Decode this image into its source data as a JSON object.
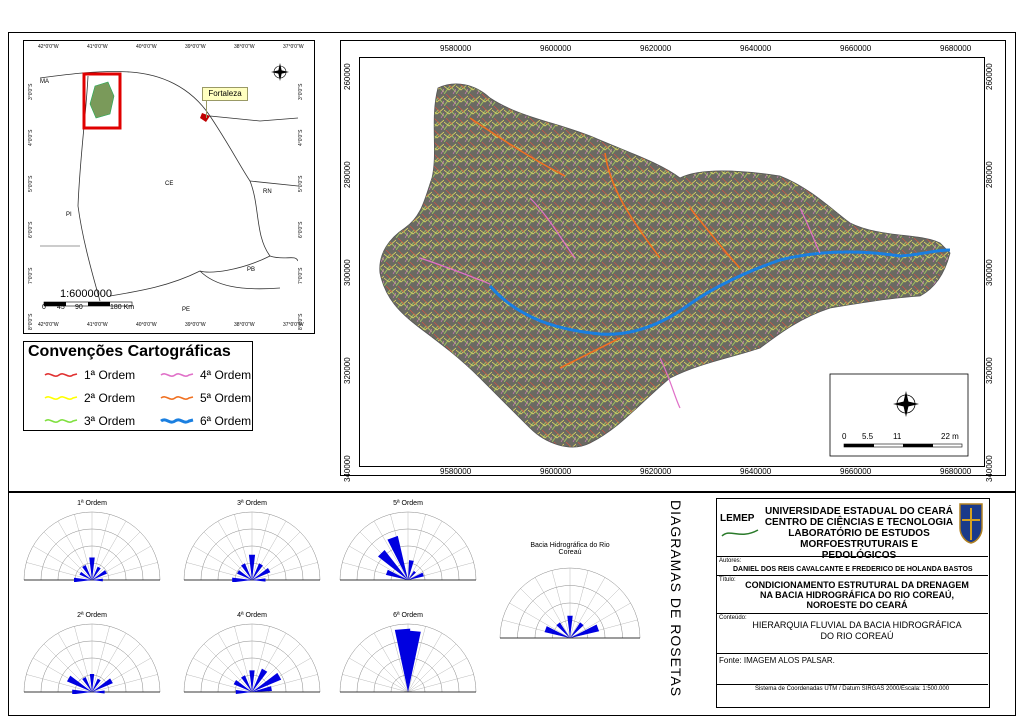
{
  "locator_map": {
    "top_ticks": [
      "42°0'0\"W",
      "41°0'0\"W",
      "40°0'0\"W",
      "39°0'0\"W",
      "38°0'0\"W",
      "37°0'0\"W"
    ],
    "bottom_ticks": [
      "42°0'0\"W",
      "41°0'0\"W",
      "40°0'0\"W",
      "39°0'0\"W",
      "38°0'0\"W",
      "37°0'0\"W"
    ],
    "left_ticks": [
      "3°0'0\"S",
      "4°0'0\"S",
      "5°0'0\"S",
      "6°0'0\"S",
      "7°0'0\"S",
      "8°0'0\"S"
    ],
    "right_ticks": [
      "3°0'0\"S",
      "4°0'0\"S",
      "5°0'0\"S",
      "6°0'0\"S",
      "7°0'0\"S",
      "8°0'0\"S"
    ],
    "state_labels": {
      "ma": "MA",
      "ce": "CE",
      "pi": "PI",
      "rn": "RN",
      "pb": "PB",
      "pe": "PE"
    },
    "city_label": "Fortaleza",
    "scale_ratio": "1:6000000",
    "scale_bar": [
      "0",
      "45",
      "90",
      "",
      "180 Km"
    ]
  },
  "legend": {
    "title": "Convenções Cartográficas",
    "items": [
      {
        "label": "1ª Ordem",
        "color": "#e03030"
      },
      {
        "label": "4ª Ordem",
        "color": "#e070c8"
      },
      {
        "label": "2ª Ordem",
        "color": "#ffff00"
      },
      {
        "label": "5ª Ordem",
        "color": "#f07020"
      },
      {
        "label": "3ª Ordem",
        "color": "#80e040"
      },
      {
        "label": "6ª Ordem",
        "color": "#1a7fe0"
      }
    ]
  },
  "main_map": {
    "top_ticks": [
      "9580000",
      "9600000",
      "9620000",
      "9640000",
      "9660000",
      "9680000"
    ],
    "bottom_ticks": [
      "9580000",
      "9600000",
      "9620000",
      "9640000",
      "9660000",
      "9680000"
    ],
    "left_ticks": [
      "260000",
      "280000",
      "300000",
      "320000",
      "340000"
    ],
    "right_ticks": [
      "260000",
      "280000",
      "300000",
      "320000",
      "340000"
    ],
    "scale_bar": [
      "0",
      "5.5",
      "11",
      "",
      "22 m"
    ]
  },
  "roses": [
    {
      "title": "1ª Ordem"
    },
    {
      "title": "3ª Ordem"
    },
    {
      "title": "5ª Ordem"
    },
    {
      "title": "2ª Ordem"
    },
    {
      "title": "4ª Ordem"
    },
    {
      "title": "6ª Ordem"
    },
    {
      "title": "Bacia Hidrográfica do Rio Coreaú"
    }
  ],
  "side_title": "DIAGRAMAS DE ROSETAS",
  "title_block": {
    "logo_text": "LEMEP",
    "institution": [
      "UNIVERSIDADE ESTADUAL DO CEARÁ",
      "CENTRO DE CIÊNCIAS E TECNOLOGIA",
      "LABORATÓRIO DE ESTUDOS",
      "MORFOESTRUTURAIS E PEDOLÓGICOS"
    ],
    "authors_label": "Autores:",
    "authors": "DANIEL DOS REIS CAVALCANTE E FREDERICO DE HOLANDA BASTOS",
    "title_label": "Título:",
    "title_lines": [
      "CONDICIONAMENTO ESTRUTURAL DA DRENAGEM",
      "NA BACIA HIDROGRÁFICA DO RIO COREAÚ,",
      "NOROESTE DO CEARÁ"
    ],
    "content_label": "Conteúdo:",
    "content_lines": [
      "HIERARQUIA FLUVIAL DA BACIA HIDROGRÁFICA",
      "DO RIO COREAÚ"
    ],
    "source": "Fonte: IMAGEM ALOS PALSAR.",
    "coords": "Sistema de Coordenadas UTM / Datum SIRGAS 2000/Escala: 1:500.000"
  }
}
